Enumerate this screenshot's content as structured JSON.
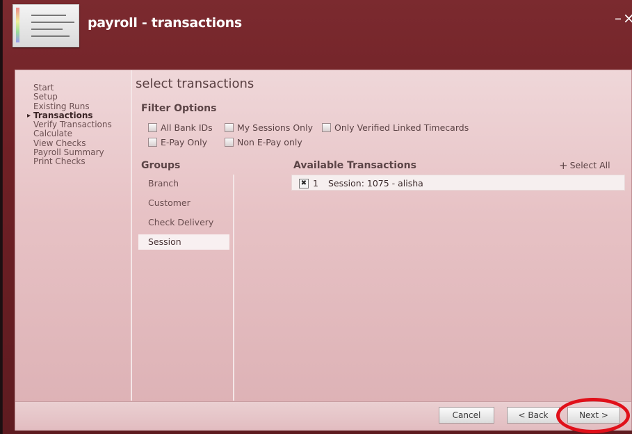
{
  "window": {
    "title": "payroll - transactions",
    "minimize_glyph": "–",
    "close_glyph": "×"
  },
  "nav": {
    "items": [
      {
        "label": "Start",
        "active": false
      },
      {
        "label": "Setup",
        "active": false
      },
      {
        "label": "Existing Runs",
        "active": false
      },
      {
        "label": "Transactions",
        "active": true
      },
      {
        "label": "Verify Transactions",
        "active": false
      },
      {
        "label": "Calculate",
        "active": false
      },
      {
        "label": "View Checks",
        "active": false
      },
      {
        "label": "Payroll Summary",
        "active": false
      },
      {
        "label": "Print Checks",
        "active": false
      }
    ]
  },
  "main": {
    "heading": "select transactions",
    "filter_options": {
      "title": "Filter Options",
      "options": [
        {
          "label": "All Bank IDs",
          "checked": false
        },
        {
          "label": "My Sessions Only",
          "checked": false
        },
        {
          "label": "Only Verified Linked Timecards",
          "checked": false
        },
        {
          "label": "E-Pay Only",
          "checked": false
        },
        {
          "label": "Non E-Pay only",
          "checked": false
        }
      ]
    },
    "groups": {
      "title": "Groups",
      "items": [
        {
          "label": "Branch",
          "selected": false
        },
        {
          "label": "Customer",
          "selected": false
        },
        {
          "label": "Check Delivery",
          "selected": false
        },
        {
          "label": "Session",
          "selected": true
        }
      ]
    },
    "available": {
      "title": "Available Transactions",
      "select_all_label": "Select All",
      "select_all_icon": "plus-icon",
      "rows": [
        {
          "checked": true,
          "check_glyph": "✖",
          "number": "1",
          "label": "Session: 1075 - alisha"
        }
      ]
    }
  },
  "footer": {
    "cancel_label": "Cancel",
    "back_label": "< Back",
    "next_label": "Next >"
  },
  "colors": {
    "window_bg": "#6f2025",
    "panel_bg": "#e7c2c5",
    "highlight": "#e0101a"
  }
}
